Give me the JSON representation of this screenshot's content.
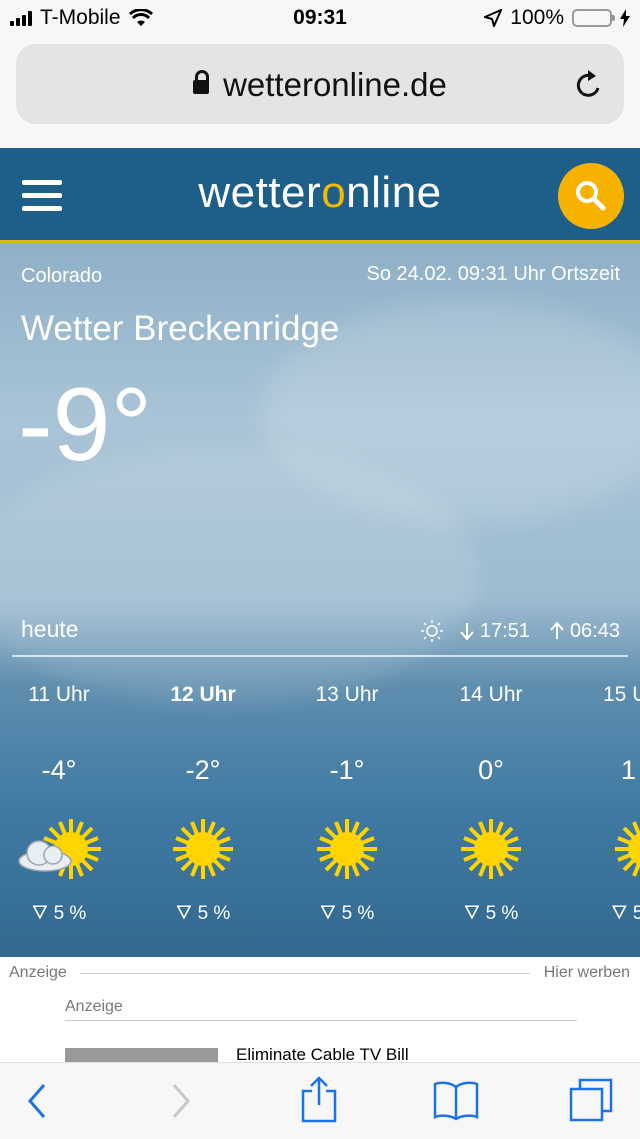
{
  "status_bar": {
    "carrier": "T-Mobile",
    "time": "09:31",
    "battery": "100%"
  },
  "browser": {
    "url": "wetteronline.de"
  },
  "header": {
    "logo_part1": "wetter",
    "logo_o": "o",
    "logo_part2": "nline"
  },
  "weather": {
    "region": "Colorado",
    "datetime": "So 24.02. 09:31 Uhr Ortszeit",
    "title": "Wetter Breckenridge",
    "temperature": "-9°",
    "day_label": "heute",
    "sunset": "17:51",
    "sunrise": "06:43"
  },
  "hourly": [
    {
      "time": "11 Uhr",
      "temp": "-4°",
      "icon": "sun-cloud-icon",
      "rain": "5 %"
    },
    {
      "time": "12 Uhr",
      "temp": "-2°",
      "icon": "sun-icon",
      "rain": "5 %"
    },
    {
      "time": "13 Uhr",
      "temp": "-1°",
      "icon": "sun-icon",
      "rain": "5 %"
    },
    {
      "time": "14 Uhr",
      "temp": "0°",
      "icon": "sun-icon",
      "rain": "5 %"
    },
    {
      "time": "15 U",
      "temp": "1",
      "icon": "sun-icon",
      "rain": "5"
    }
  ],
  "ads": {
    "label": "Anzeige",
    "advertise": "Hier werben",
    "inner_label": "Anzeige",
    "headline": "Eliminate Cable TV Bill"
  },
  "colors": {
    "header_bg": "#1e5f8a",
    "accent": "#f7b200",
    "sun": "#ffd400"
  }
}
